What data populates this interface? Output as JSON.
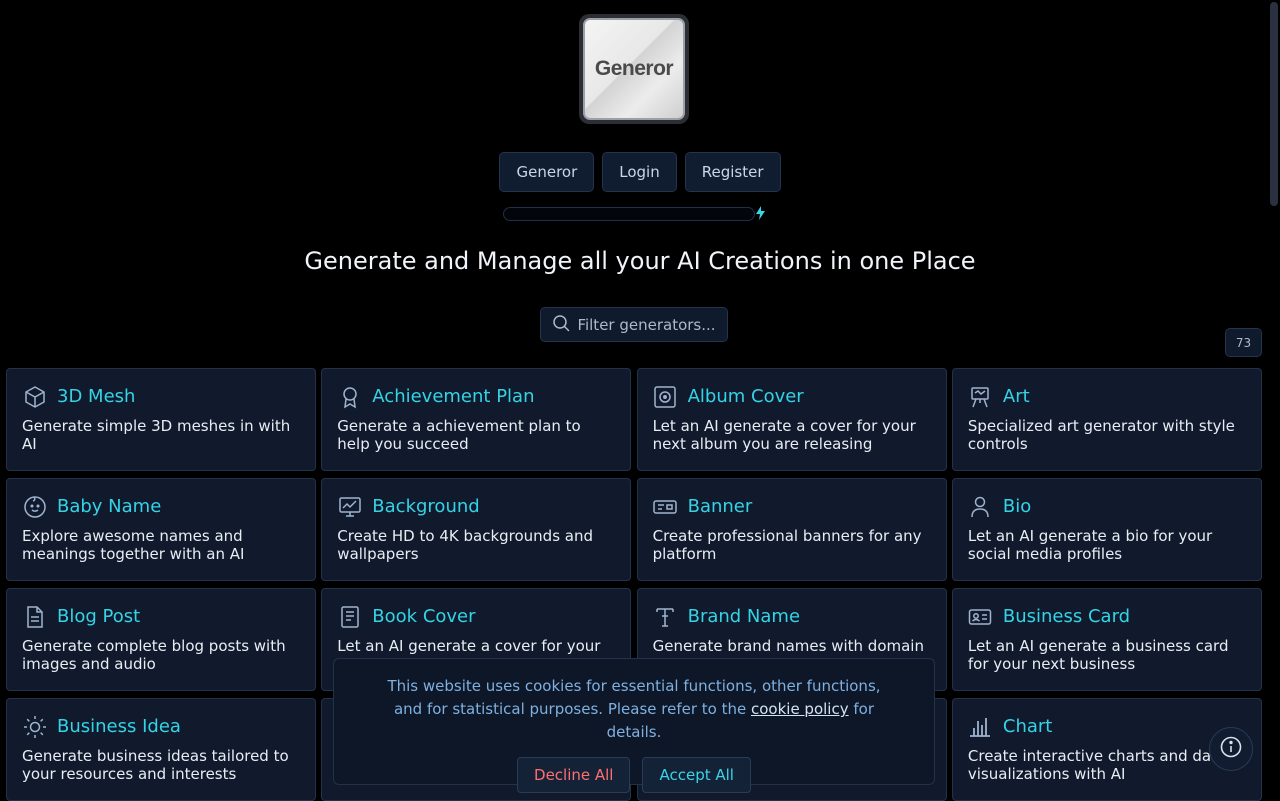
{
  "logo": {
    "text": "Generor"
  },
  "nav": {
    "items": [
      "Generor",
      "Login",
      "Register"
    ]
  },
  "headline": "Generate and Manage all your AI Creations in one Place",
  "filter": {
    "placeholder": "Filter generators..."
  },
  "generator_count": "73",
  "cards": [
    {
      "title": "3D Mesh",
      "desc": "Generate simple 3D meshes in with AI",
      "icon": "cube-icon"
    },
    {
      "title": "Achievement Plan",
      "desc": "Generate a achievement plan to help you succeed",
      "icon": "award-icon"
    },
    {
      "title": "Album Cover",
      "desc": "Let an AI generate a cover for your next album you are releasing",
      "icon": "vinyl-icon"
    },
    {
      "title": "Art",
      "desc": "Specialized art generator with style controls",
      "icon": "easel-icon"
    },
    {
      "title": "Baby Name",
      "desc": "Explore awesome names and meanings together with an AI",
      "icon": "baby-face-icon"
    },
    {
      "title": "Background",
      "desc": "Create HD to 4K backgrounds and wallpapers",
      "icon": "monitor-chart-icon"
    },
    {
      "title": "Banner",
      "desc": "Create professional banners for any platform",
      "icon": "banner-icon"
    },
    {
      "title": "Bio",
      "desc": "Let an AI generate a bio for your social media profiles",
      "icon": "person-icon"
    },
    {
      "title": "Blog Post",
      "desc": "Generate complete blog posts with images and audio",
      "icon": "document-icon"
    },
    {
      "title": "Book Cover",
      "desc": "Let an AI generate a cover for your",
      "icon": "book-icon"
    },
    {
      "title": "Brand Name",
      "desc": "Generate brand names with domain",
      "icon": "typography-icon"
    },
    {
      "title": "Business Card",
      "desc": "Let an AI generate a business card for your next business",
      "icon": "id-card-icon"
    },
    {
      "title": "Business Idea",
      "desc": "Generate business ideas tailored to your resources and interests",
      "icon": "sun-icon"
    },
    {
      "title": "",
      "desc": "",
      "icon": ""
    },
    {
      "title": "",
      "desc": "",
      "icon": ""
    },
    {
      "title": "Chart",
      "desc": "Create interactive charts and data visualizations with AI",
      "icon": "bar-chart-icon"
    }
  ],
  "cookie": {
    "text_before": "This website uses cookies for essential functions, other functions, and for statistical purposes. Please refer to the ",
    "link": "cookie policy",
    "text_after": " for details.",
    "decline": "Decline All",
    "accept": "Accept All"
  },
  "colors": {
    "accent": "#34d3e6",
    "card_bg": "#101a2c",
    "decline": "#ff6f6f"
  }
}
